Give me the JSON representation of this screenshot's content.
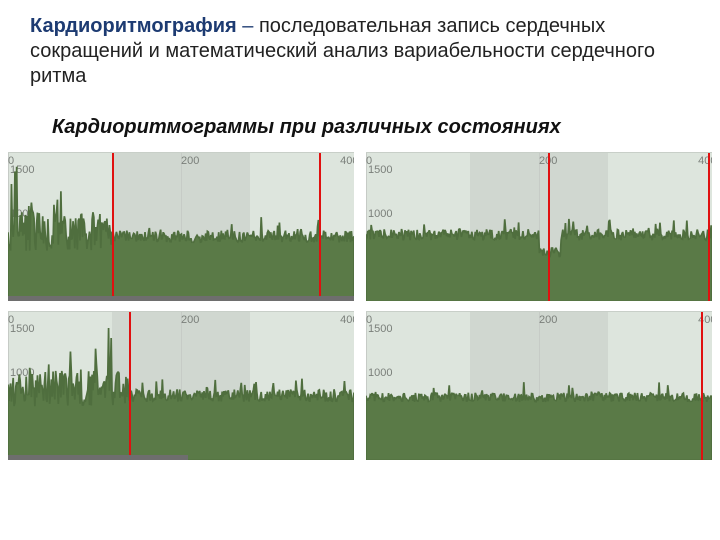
{
  "title": {
    "term": "Кардиоритмография",
    "sep": " – ",
    "rest": "последовательная запись сердечных сокращений и математический анализ вариабельности сердечного ритма"
  },
  "subtitle": "Кардиоритмограммы при различных состояниях",
  "axis": {
    "x0": "0",
    "x200": "200",
    "x400": "400",
    "y1500": "1500",
    "y1000": "1000"
  },
  "chart_data": [
    {
      "type": "area",
      "title": "",
      "xlabel": "",
      "ylabel": "",
      "xlim": [
        0,
        400
      ],
      "ylim": [
        0,
        1700
      ],
      "red_markers_x": [
        120,
        360
      ],
      "footer_bar_pct": 100,
      "profile_notes": "high-variability spiky segment x≈0–120, spikes reaching ~1200; flatter noisy plateau ~700–800 thereafter",
      "x_ticks": [
        0,
        200,
        400
      ],
      "y_ticks": [
        1000,
        1500
      ]
    },
    {
      "type": "area",
      "title": "",
      "xlabel": "",
      "ylabel": "",
      "xlim": [
        0,
        400
      ],
      "ylim": [
        0,
        1700
      ],
      "red_markers_x": [
        210,
        395
      ],
      "footer_bar_pct": 0,
      "profile_notes": "steady noisy plateau ~750 across full width; brief dip near x≈210",
      "x_ticks": [
        0,
        200,
        400
      ],
      "y_ticks": [
        1000,
        1500
      ]
    },
    {
      "type": "area",
      "title": "",
      "xlabel": "",
      "ylabel": "",
      "xlim": [
        0,
        400
      ],
      "ylim": [
        0,
        1700
      ],
      "red_markers_x": [
        140
      ],
      "footer_bar_pct": 52,
      "profile_notes": "dense spiky segment x≈0–140, peaks ~1100–1200; lower noisy plateau ~700–800 after",
      "x_ticks": [
        0,
        200,
        400
      ],
      "y_ticks": [
        1000,
        1500
      ]
    },
    {
      "type": "area",
      "title": "",
      "xlabel": "",
      "ylabel": "",
      "xlim": [
        0,
        400
      ],
      "ylim": [
        0,
        1700
      ],
      "red_markers_x": [
        387
      ],
      "footer_bar_pct": 0,
      "profile_notes": "steady noisy plateau ~700–750 across full width",
      "x_ticks": [
        0,
        200,
        400
      ],
      "y_ticks": [
        1000,
        1500
      ]
    }
  ]
}
